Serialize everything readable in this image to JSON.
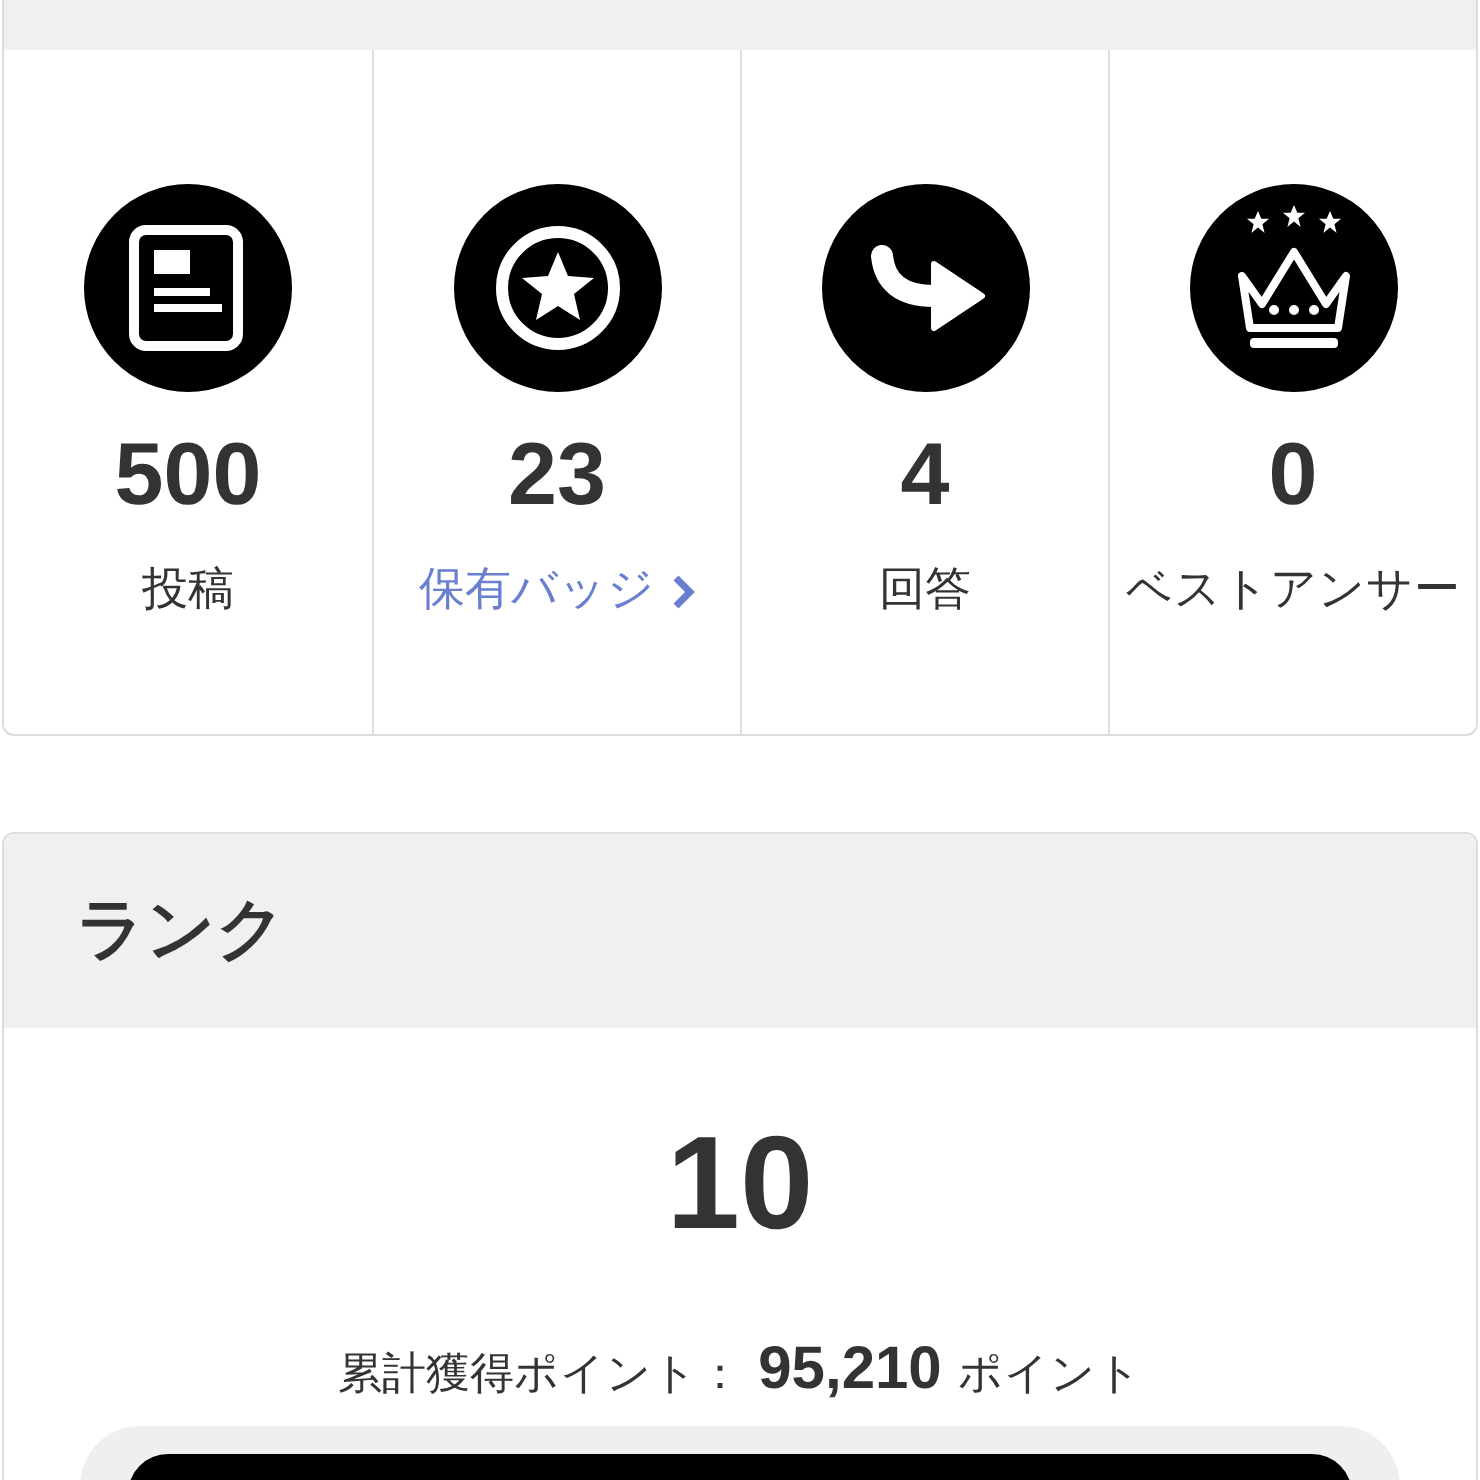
{
  "stats": [
    {
      "kind": "article",
      "value": "500",
      "label": "投稿",
      "link": false
    },
    {
      "kind": "badge",
      "value": "23",
      "label": "保有バッジ",
      "link": true
    },
    {
      "kind": "answer",
      "value": "4",
      "label": "回答",
      "link": false
    },
    {
      "kind": "crown",
      "value": "0",
      "label": "ベストアンサー",
      "link": false
    }
  ],
  "rank": {
    "title": "ランク",
    "value": "10",
    "points_label": "累計獲得ポイント：",
    "points_value": "95,210",
    "points_unit": "ポイント"
  }
}
